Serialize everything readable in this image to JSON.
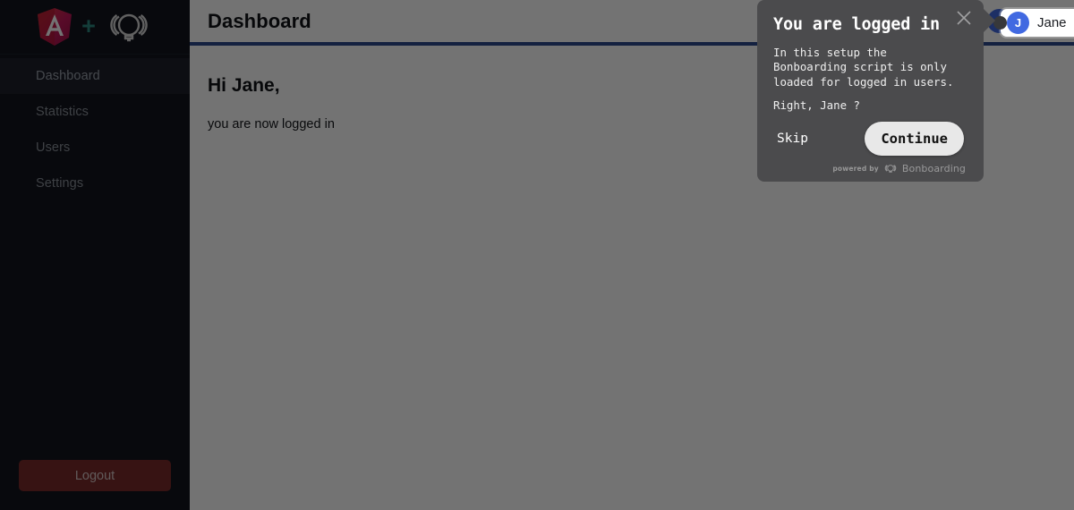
{
  "sidebar": {
    "logo": {
      "angular_icon": "angular-shield-icon",
      "plus_icon": "plus-icon",
      "bonboarding_icon": "bonboarding-bulb-icon"
    },
    "items": [
      {
        "label": "Dashboard",
        "active": true
      },
      {
        "label": "Statistics",
        "active": false
      },
      {
        "label": "Users",
        "active": false
      },
      {
        "label": "Settings",
        "active": false
      }
    ],
    "logout_label": "Logout"
  },
  "topbar": {
    "title": "Dashboard",
    "accent_color": "#2d4b8e",
    "user": {
      "initial": "J",
      "name": "Jane",
      "avatar_color": "#4169e1"
    }
  },
  "main": {
    "greeting": "Hi Jane,",
    "subtext": "you are now logged in"
  },
  "tooltip": {
    "title": "You are logged in",
    "body_line_1": "In this setup the Bonboarding script is only loaded for logged in users.",
    "body_line_2": "Right, Jane ?",
    "skip_label": "Skip",
    "continue_label": "Continue",
    "close_icon": "close-icon",
    "powered_by_label": "powered by",
    "powered_by_name": "Bonboarding",
    "background_color": "#4b4b4d"
  }
}
